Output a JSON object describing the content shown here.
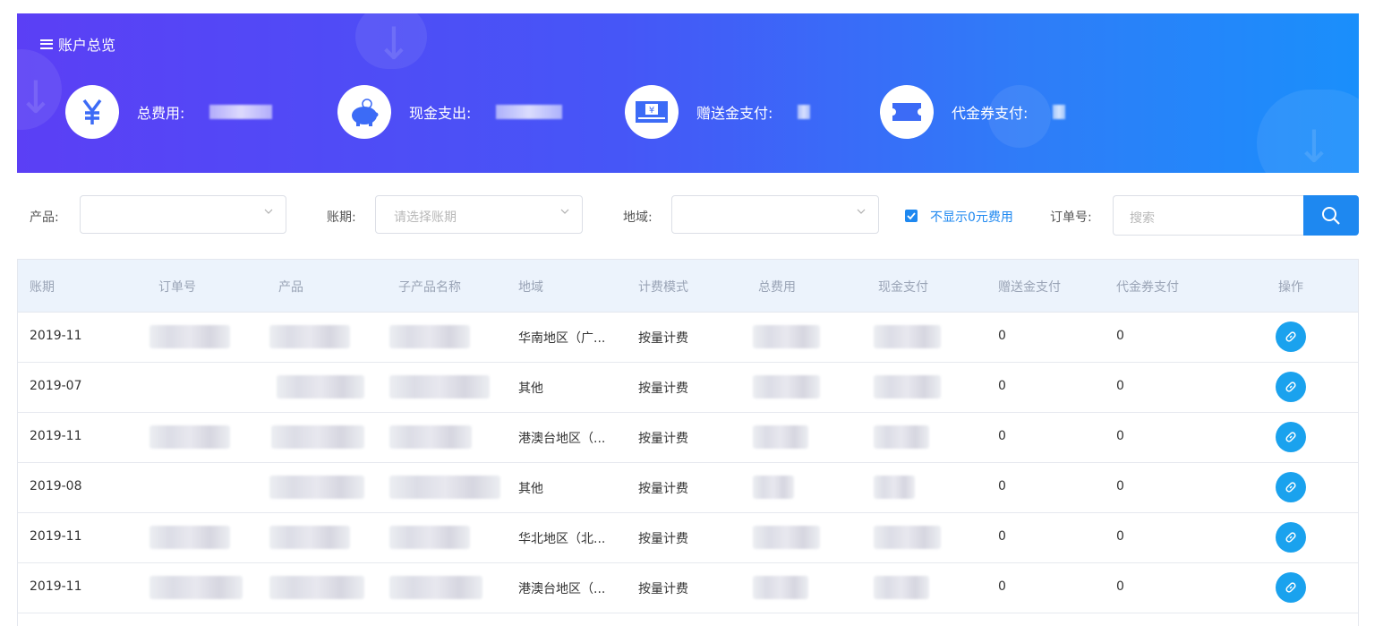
{
  "banner": {
    "title": "账户总览",
    "stats": [
      {
        "label": "总费用:",
        "icon": "yen-icon"
      },
      {
        "label": "现金支出:",
        "icon": "piggy-bank-icon"
      },
      {
        "label": "赠送金支付:",
        "icon": "cash-note-icon"
      },
      {
        "label": "代金券支付:",
        "icon": "ticket-icon"
      }
    ],
    "colors": {
      "start": "#5b3ff5",
      "end": "#1a8ffb"
    }
  },
  "filters": {
    "product_label": "产品:",
    "period_label": "账期:",
    "period_placeholder": "请选择账期",
    "region_label": "地域:",
    "hide_zero_label": "不显示0元费用",
    "order_label": "订单号:",
    "search_placeholder": "搜索"
  },
  "table": {
    "headers": [
      "账期",
      "订单号",
      "产品",
      "子产品名称",
      "地域",
      "计费模式",
      "总费用",
      "现金支付",
      "赠送金支付",
      "代金券支付",
      "操作"
    ],
    "rows": [
      {
        "period": "2019-11",
        "region": "华南地区（广...",
        "billing": "按量计费",
        "gift": "0",
        "voucher": "0"
      },
      {
        "period": "2019-07",
        "region": "其他",
        "billing": "按量计费",
        "gift": "0",
        "voucher": "0"
      },
      {
        "period": "2019-11",
        "region": "港澳台地区（...",
        "billing": "按量计费",
        "gift": "0",
        "voucher": "0"
      },
      {
        "period": "2019-08",
        "region": "其他",
        "billing": "按量计费",
        "gift": "0",
        "voucher": "0"
      },
      {
        "period": "2019-11",
        "region": "华北地区（北...",
        "billing": "按量计费",
        "gift": "0",
        "voucher": "0"
      },
      {
        "period": "2019-11",
        "region": "港澳台地区（...",
        "billing": "按量计费",
        "gift": "0",
        "voucher": "0"
      }
    ]
  },
  "accent": "#1e88f0"
}
